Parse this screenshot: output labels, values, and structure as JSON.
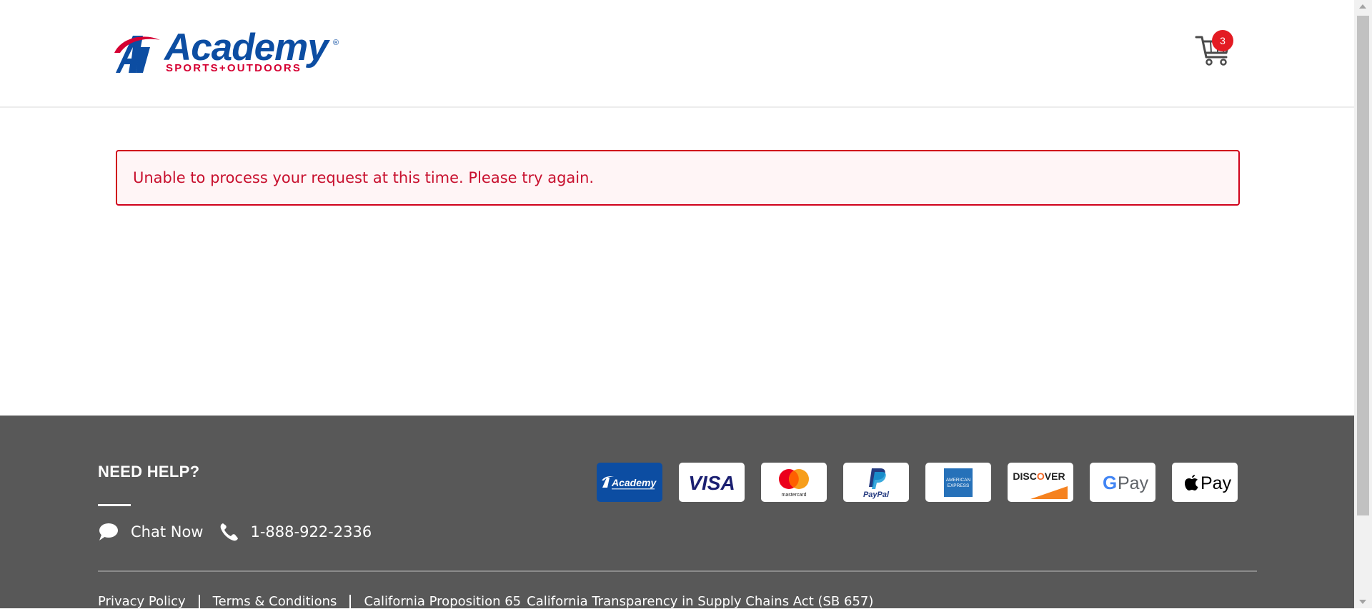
{
  "header": {
    "logo": {
      "wordmark": "Academy",
      "tagline": "SPORTS+OUTDOORS",
      "registered": "®"
    },
    "cart": {
      "icon": "shopping-cart-icon",
      "count": "3",
      "badge_color": "#e31b23"
    }
  },
  "main": {
    "error_message": "Unable to process your request at this time. Please try again.",
    "error_color": "#c8102e"
  },
  "footer": {
    "help_heading": "NEED HELP?",
    "chat_icon": "chat-bubble-icon",
    "chat_label": "Chat Now",
    "phone_icon": "phone-icon",
    "phone_number": "1-888-922-2336",
    "payment_methods": [
      {
        "name": "Academy",
        "icon": "academy-card-icon"
      },
      {
        "name": "VISA",
        "icon": "visa-icon"
      },
      {
        "name": "mastercard",
        "icon": "mastercard-icon"
      },
      {
        "name": "PayPal",
        "icon": "paypal-icon"
      },
      {
        "name": "AMERICAN EXPRESS",
        "icon": "amex-icon"
      },
      {
        "name": "DISCOVER",
        "icon": "discover-icon"
      },
      {
        "name": "G Pay",
        "icon": "google-pay-icon"
      },
      {
        "name": "Pay",
        "icon": "apple-pay-icon"
      }
    ],
    "links": [
      "Privacy Policy",
      "Terms & Conditions",
      "California Proposition 65",
      "California Transparency in Supply Chains Act (SB 657)"
    ],
    "background": "#585858"
  }
}
